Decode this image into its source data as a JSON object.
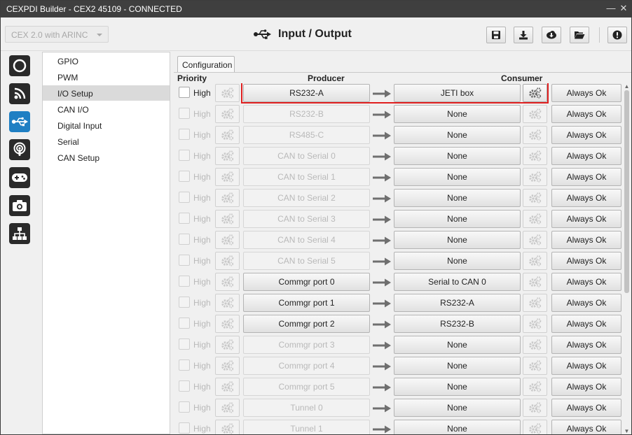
{
  "window": {
    "title": "CEXPDI Builder - CEX2 45109 - CONNECTED"
  },
  "toolbar": {
    "device": "CEX 2.0 with ARINC",
    "page_title": "Input / Output"
  },
  "menu": {
    "items": [
      "GPIO",
      "PWM",
      "I/O Setup",
      "CAN I/O",
      "Digital Input",
      "Serial",
      "CAN Setup"
    ],
    "selected": "I/O Setup"
  },
  "tab": {
    "label": "Configuration"
  },
  "columns": {
    "priority": "Priority",
    "producer": "Producer",
    "consumer": "Consumer"
  },
  "rows": [
    {
      "priority": "High",
      "producer": "RS232-A",
      "consumer": "JETI box",
      "status": "Always Ok"
    },
    {
      "priority": "High",
      "producer": "RS232-B",
      "consumer": "None",
      "status": "Always Ok"
    },
    {
      "priority": "High",
      "producer": "RS485-C",
      "consumer": "None",
      "status": "Always Ok"
    },
    {
      "priority": "High",
      "producer": "CAN to Serial 0",
      "consumer": "None",
      "status": "Always Ok"
    },
    {
      "priority": "High",
      "producer": "CAN to Serial 1",
      "consumer": "None",
      "status": "Always Ok"
    },
    {
      "priority": "High",
      "producer": "CAN to Serial 2",
      "consumer": "None",
      "status": "Always Ok"
    },
    {
      "priority": "High",
      "producer": "CAN to Serial 3",
      "consumer": "None",
      "status": "Always Ok"
    },
    {
      "priority": "High",
      "producer": "CAN to Serial 4",
      "consumer": "None",
      "status": "Always Ok"
    },
    {
      "priority": "High",
      "producer": "CAN to Serial 5",
      "consumer": "None",
      "status": "Always Ok"
    },
    {
      "priority": "High",
      "producer": "Commgr port 0",
      "consumer": "Serial to CAN 0",
      "status": "Always Ok"
    },
    {
      "priority": "High",
      "producer": "Commgr port 1",
      "consumer": "RS232-A",
      "status": "Always Ok"
    },
    {
      "priority": "High",
      "producer": "Commgr port 2",
      "consumer": "RS232-B",
      "status": "Always Ok"
    },
    {
      "priority": "High",
      "producer": "Commgr port 3",
      "consumer": "None",
      "status": "Always Ok"
    },
    {
      "priority": "High",
      "producer": "Commgr port 4",
      "consumer": "None",
      "status": "Always Ok"
    },
    {
      "priority": "High",
      "producer": "Commgr port 5",
      "consumer": "None",
      "status": "Always Ok"
    },
    {
      "priority": "High",
      "producer": "Tunnel 0",
      "consumer": "None",
      "status": "Always Ok"
    },
    {
      "priority": "High",
      "producer": "Tunnel 1",
      "consumer": "None",
      "status": "Always Ok"
    }
  ],
  "row_state": {
    "enabled_producers": [
      0,
      9,
      10,
      11
    ],
    "enabled_consumer_gear": [
      0
    ],
    "highlighted_row": 0,
    "highlight_color": "#e02020"
  },
  "icons": {
    "window_buttons": [
      "minimize-icon",
      "close-icon"
    ],
    "toolbar": [
      "save-icon",
      "download-icon",
      "cloud-download-icon",
      "folder-open-icon",
      "info-icon"
    ],
    "sidebar": [
      "power-circle-icon",
      "rss-icon",
      "usb-icon",
      "podcast-icon",
      "gamepad-icon",
      "camera-icon",
      "sitemap-icon"
    ],
    "active_sidebar": "usb-icon",
    "accent": "#1f7fc3"
  }
}
